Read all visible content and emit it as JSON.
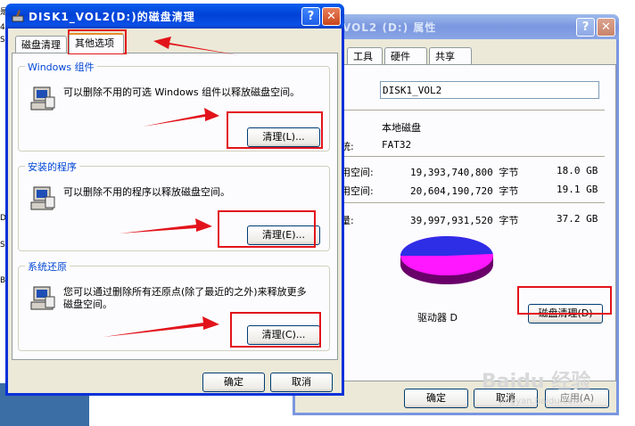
{
  "cleanup_dialog": {
    "title": "DISK1_VOL2(D:)的磁盘清理",
    "help_btn": "?",
    "close_btn": "✕",
    "tabs": [
      "磁盘清理",
      "其他选项"
    ],
    "groups": [
      {
        "label": "Windows 组件",
        "text": "可以删除不用的可选 Windows 组件以释放磁盘空间。",
        "button": "清理(L)..."
      },
      {
        "label": "安装的程序",
        "text": "可以删除不用的程序以释放磁盘空间。",
        "button": "清理(E)..."
      },
      {
        "label": "系统还原",
        "text": "您可以通过删除所有还原点(除了最近的之外)来释放更多磁盘空间。",
        "button": "清理(C)..."
      }
    ],
    "ok_button": "确定",
    "cancel_button": "取消"
  },
  "properties_dialog": {
    "title": "VOL2 (D:) 属性",
    "help_btn": "?",
    "close_btn": "✕",
    "tabs": [
      "工具",
      "硬件",
      "共享"
    ],
    "volume_name": "DISK1_VOL2",
    "type_value": "本地磁盘",
    "fs_label": "统:",
    "fs_value": "FAT32",
    "used_label": "用空间:",
    "used_bytes": "19,393,740,800 字节",
    "used_gb": "18.0 GB",
    "free_label": "用空间:",
    "free_bytes": "20,604,190,720 字节",
    "free_gb": "19.1 GB",
    "cap_label": "量:",
    "cap_bytes": "39,997,931,520 字节",
    "cap_gb": "37.2 GB",
    "used_fraction": 0.485,
    "drive_label": "驱动器 D",
    "cleanup_button": "磁盘清理(D)",
    "ok_button": "确定",
    "cancel_button": "取消",
    "apply_button": "应用(A)"
  },
  "background": {
    "glyphs": [
      "是",
      "4",
      "S",
      "D",
      "B",
      "S"
    ],
    "frag_text": "4"
  },
  "watermark": {
    "text": "Baidu 经验",
    "sub": "jingyan.baidu.com"
  },
  "colors": {
    "used": "#2e2ee6",
    "free": "#ff17ff",
    "highlight": "#e2141b"
  }
}
